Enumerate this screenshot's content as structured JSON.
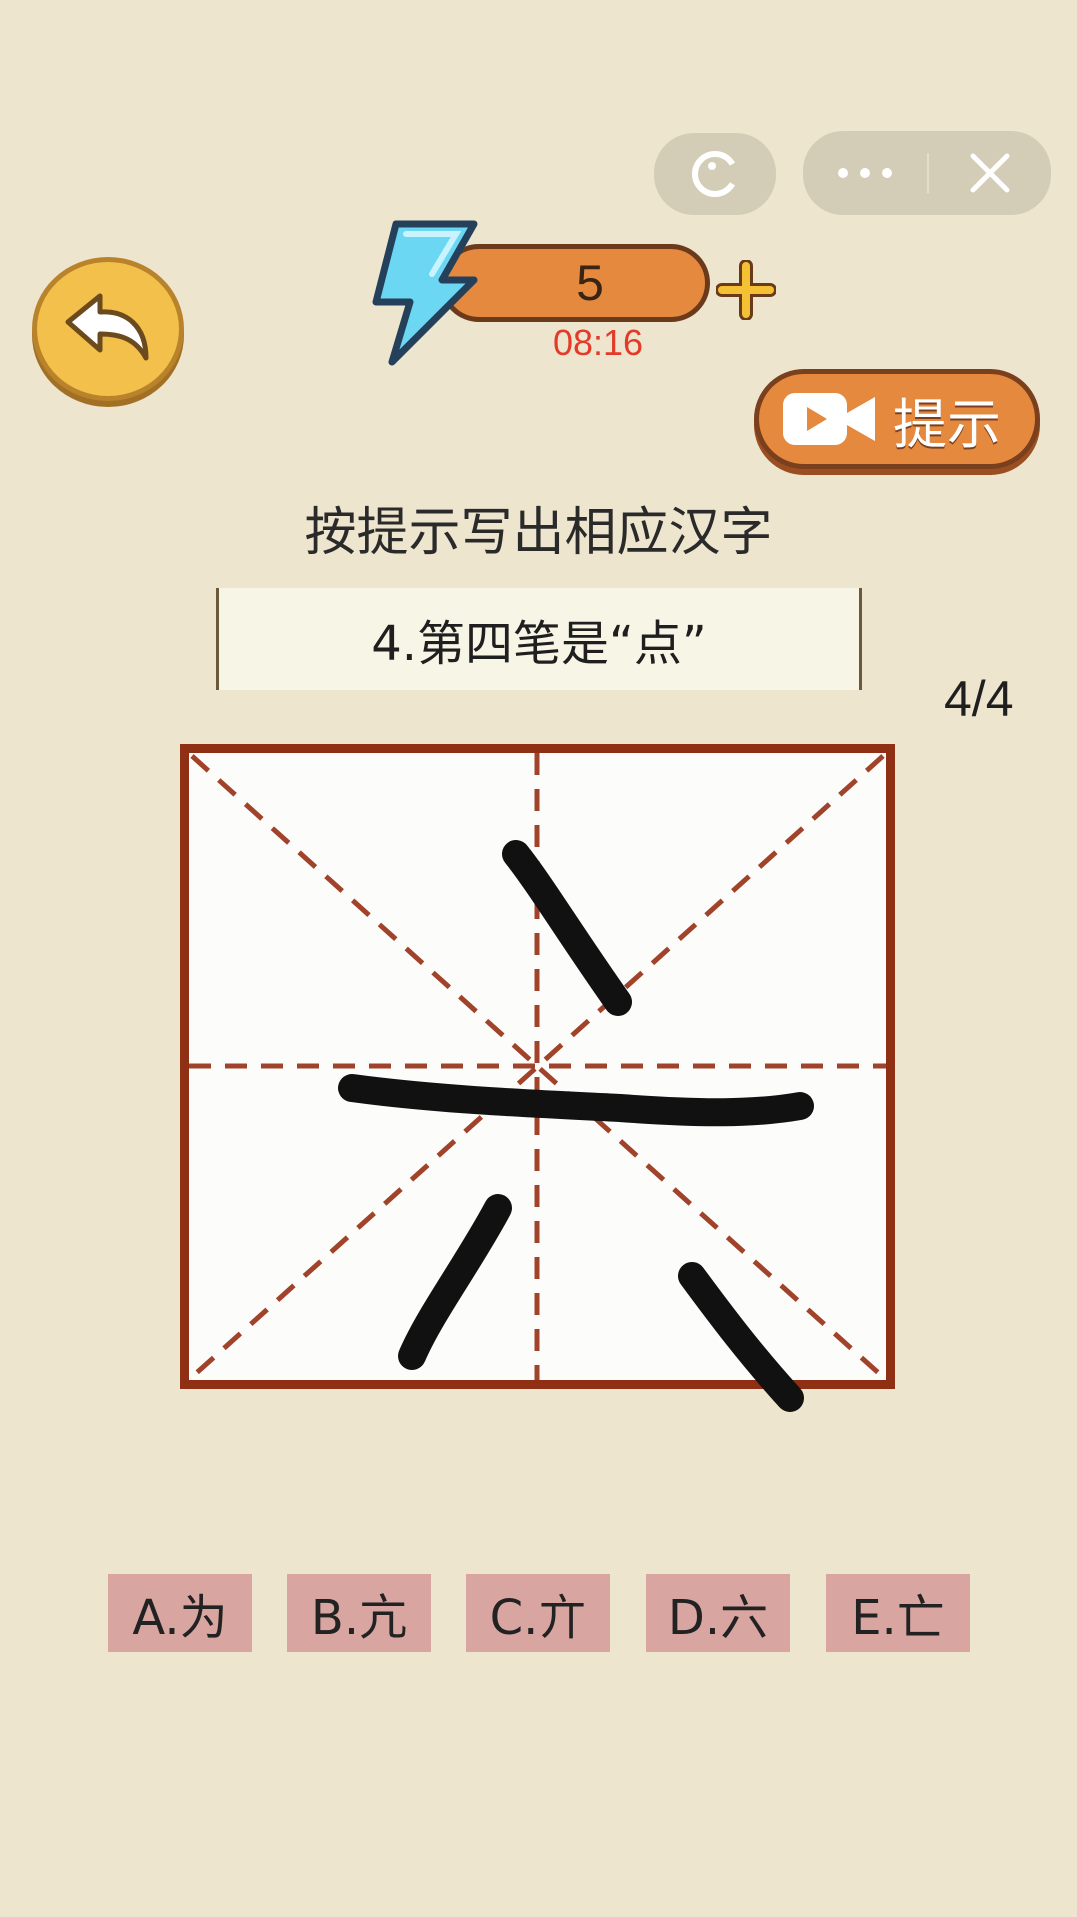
{
  "header": {
    "energy": "5",
    "timer": "08:16",
    "hint_label": "提示"
  },
  "capsule": {
    "game_icon": "game-face-icon",
    "more_icon": "more-dots-icon",
    "close_icon": "close-icon"
  },
  "instruction": "按提示写出相应汉字",
  "question": "4.第四笔是“点”",
  "progress": "4/4",
  "options": [
    {
      "label": "A.为"
    },
    {
      "label": "B.亢"
    },
    {
      "label": "C.亣"
    },
    {
      "label": "D.六"
    },
    {
      "label": "E.亡"
    }
  ],
  "colors": {
    "background": "#ede5cd",
    "accent": "#e5893f",
    "grid_border": "#8f2f13",
    "guide_line": "#a0432a",
    "option_bg": "#d8a5a1",
    "timer": "#e43a2a"
  }
}
